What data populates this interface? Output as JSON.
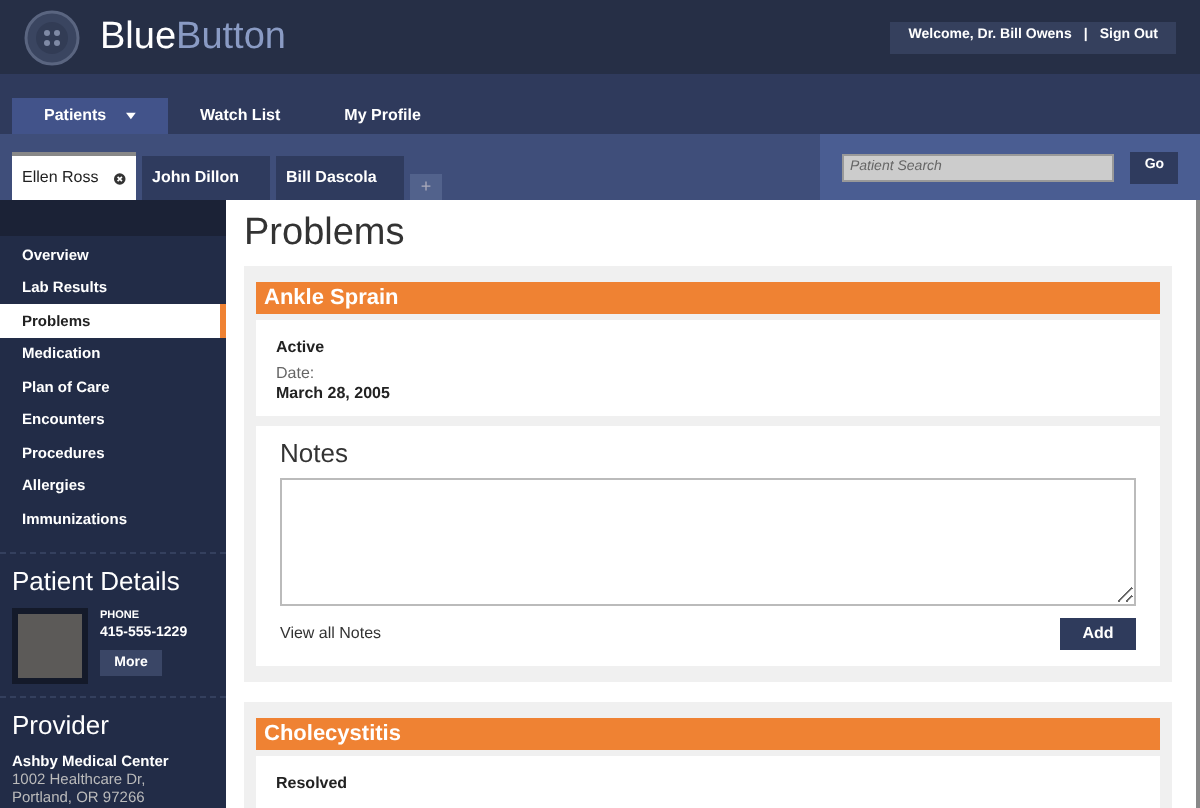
{
  "header": {
    "brand_strong": "Blue",
    "brand_light": "Button",
    "welcome": "Welcome,  Dr. Bill Owens",
    "separator": "|",
    "sign_out": "Sign Out"
  },
  "nav": [
    {
      "label": "Patients",
      "selected": true,
      "dropdown": true
    },
    {
      "label": "Watch List",
      "selected": false,
      "dropdown": false
    },
    {
      "label": "My Profile",
      "selected": false,
      "dropdown": false
    }
  ],
  "patient_tabs": [
    {
      "label": "Ellen Ross",
      "selected": true
    },
    {
      "label": "John Dillon",
      "selected": false
    },
    {
      "label": "Bill Dascola",
      "selected": false
    }
  ],
  "add_tab": "+",
  "search": {
    "placeholder": "Patient Search",
    "button": "Go"
  },
  "sidebar": {
    "items": [
      {
        "label": "Overview",
        "selected": false
      },
      {
        "label": "Lab Results",
        "selected": false
      },
      {
        "label": "Problems",
        "selected": true
      },
      {
        "label": "Medication",
        "selected": false
      },
      {
        "label": "Plan of Care",
        "selected": false
      },
      {
        "label": "Encounters",
        "selected": false
      },
      {
        "label": "Procedures",
        "selected": false
      },
      {
        "label": "Allergies",
        "selected": false
      },
      {
        "label": "Immunizations",
        "selected": false
      }
    ],
    "patient_details": {
      "title": "Patient Details",
      "phone_label": "PHONE",
      "phone": "415-555-1229",
      "more": "More"
    },
    "provider": {
      "title": "Provider",
      "name": "Ashby Medical Center",
      "address_1": "1002 Healthcare Dr,",
      "address_2": "Portland, OR 97266"
    }
  },
  "page_title": "Problems",
  "problems": [
    {
      "title": "Ankle Sprain",
      "status": "Active",
      "date_label": "Date:",
      "date": "March 28, 2005",
      "notes": {
        "title": "Notes",
        "link": "View all Notes",
        "button": "Add"
      }
    },
    {
      "title": "Cholecystitis",
      "status": "Resolved"
    }
  ]
}
